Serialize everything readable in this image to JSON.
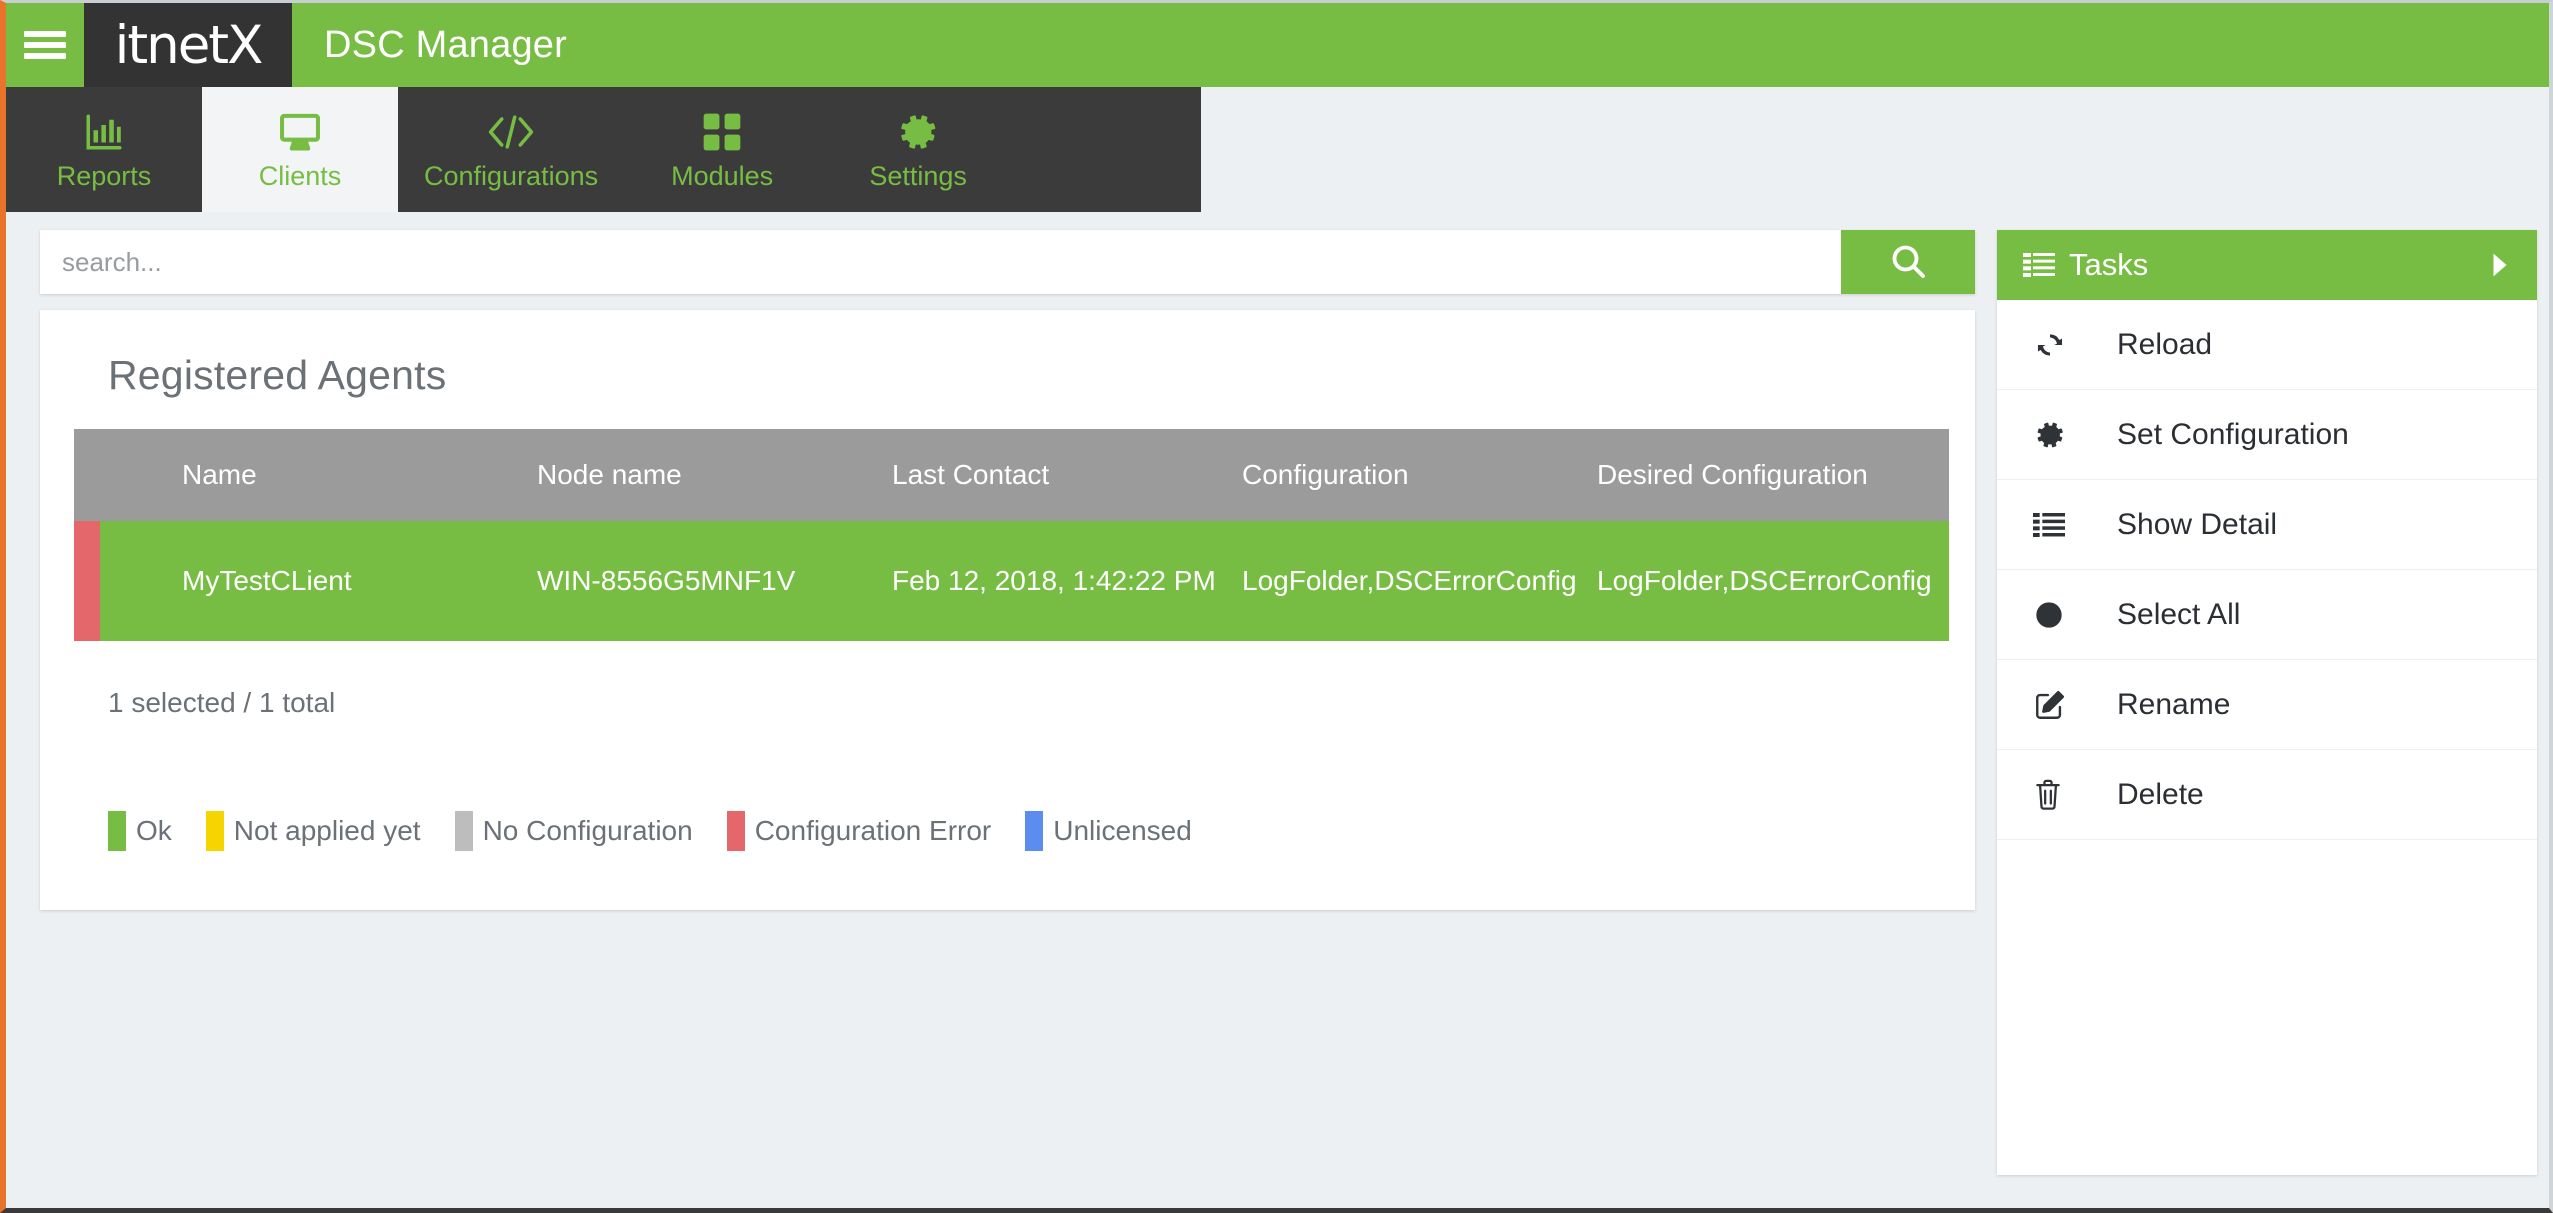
{
  "brand": {
    "menu_icon": "hamburger-icon",
    "logo_text": "itnetX",
    "app_title": "DSC Manager",
    "brand_green": "#77bd43",
    "logo_bg": "#333333"
  },
  "nav": {
    "tabs": [
      {
        "label": "Reports",
        "icon": "bar-chart-icon",
        "active": false
      },
      {
        "label": "Clients",
        "icon": "monitor-icon",
        "active": true
      },
      {
        "label": "Configurations",
        "icon": "code-icon",
        "active": false
      },
      {
        "label": "Modules",
        "icon": "grid-icon",
        "active": false
      },
      {
        "label": "Settings",
        "icon": "gear-icon",
        "active": false
      }
    ]
  },
  "search": {
    "placeholder": "search...",
    "value": "",
    "button_icon": "search-icon"
  },
  "main": {
    "card_title": "Registered Agents",
    "table": {
      "columns": [
        "Name",
        "Node name",
        "Last Contact",
        "Configuration",
        "Desired Configuration"
      ],
      "rows": [
        {
          "status_icon": "circle-icon",
          "accent_color": "#e4686b",
          "row_color": "#77bd43",
          "name": "MyTestCLient",
          "node_name": "WIN-8556G5MNF1V",
          "last_contact": "Feb 12, 2018, 1:42:22 PM",
          "configuration": "LogFolder,DSCErrorConfig",
          "desired_configuration": "LogFolder,DSCErrorConfig"
        }
      ]
    },
    "count_text": "1 selected / 1 total",
    "legend": [
      {
        "label": "Ok",
        "color": "#77bd43"
      },
      {
        "label": "Not applied yet",
        "color": "#f5d400"
      },
      {
        "label": "No Configuration",
        "color": "#bdbdbd"
      },
      {
        "label": "Configuration Error",
        "color": "#e4686b"
      },
      {
        "label": "Unlicensed",
        "color": "#5b8def"
      }
    ]
  },
  "tasks": {
    "header_title": "Tasks",
    "header_icon": "list-icon",
    "header_arrow_icon": "chevron-right-icon",
    "items": [
      {
        "label": "Reload",
        "icon": "refresh-icon"
      },
      {
        "label": "Set Configuration",
        "icon": "gear-icon"
      },
      {
        "label": "Show Detail",
        "icon": "list-detail-icon"
      },
      {
        "label": "Select All",
        "icon": "filled-circle-icon"
      },
      {
        "label": "Rename",
        "icon": "pencil-square-icon"
      },
      {
        "label": "Delete",
        "icon": "trash-icon"
      }
    ]
  }
}
